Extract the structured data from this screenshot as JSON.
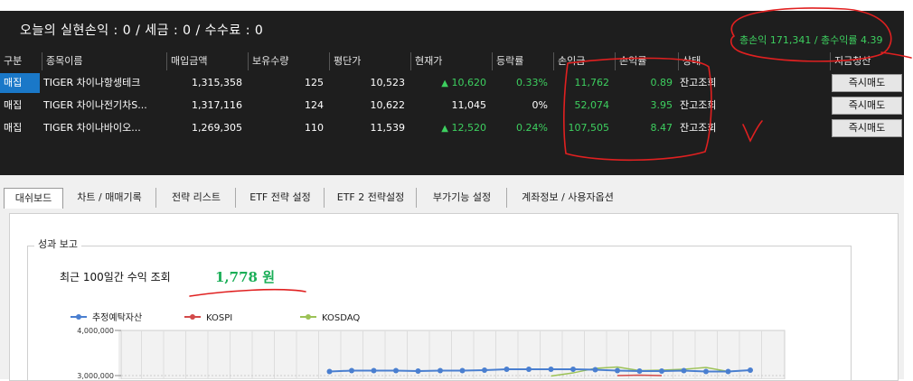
{
  "summary": "오늘의 실현손익 : 0 / 세금 : 0 / 수수료 : 0",
  "totals": "총손익 171,341 / 총수익률 4.39",
  "columns": [
    "구분",
    "종목이름",
    "매입금액",
    "보유수량",
    "평단가",
    "현재가",
    "등락률",
    "손익금",
    "손익률",
    "상태",
    "지금청산"
  ],
  "rows": [
    {
      "type": "매집",
      "name": "TIGER 차이나항셍테크",
      "buy": "1,315,358",
      "qty": "125",
      "avg": "10,523",
      "cur": "10,620",
      "up": true,
      "rate": "0.33%",
      "pnl": "11,762",
      "pnl_rate": "0.89",
      "status": "잔고조회",
      "action": "즉시매도"
    },
    {
      "type": "매집",
      "name": "TIGER 차이나전기차S...",
      "buy": "1,317,116",
      "qty": "124",
      "avg": "10,622",
      "cur": "11,045",
      "up": false,
      "rate": "0%",
      "pnl": "52,074",
      "pnl_rate": "3.95",
      "status": "잔고조회",
      "action": "즉시매도"
    },
    {
      "type": "매집",
      "name": "TIGER 차이나바이오...",
      "buy": "1,269,305",
      "qty": "110",
      "avg": "11,539",
      "cur": "12,520",
      "up": true,
      "rate": "0.24%",
      "pnl": "107,505",
      "pnl_rate": "8.47",
      "status": "잔고조회",
      "action": "즉시매도"
    }
  ],
  "tabs": [
    "대쉬보드",
    "차트 / 매매기록",
    "전략 리스트",
    "ETF 전략 설정",
    "ETF 2 전략설정",
    "부가기능 설정",
    "계좌정보 / 사용자옵션"
  ],
  "report": {
    "group_title": "성과 보고",
    "label": "최근 100일간 수익 조회",
    "value": "1,778 원"
  },
  "chart_data": {
    "type": "line",
    "series": [
      {
        "name": "추정예탁자산",
        "color": "#4a7fd0",
        "values": [
          null,
          null,
          null,
          null,
          null,
          null,
          null,
          null,
          null,
          3090000,
          3110000,
          3110000,
          3110000,
          3100000,
          3110000,
          3110000,
          3120000,
          3140000,
          3140000,
          3140000,
          3140000,
          3130000,
          3110000,
          3100000,
          3100000,
          3110000,
          3090000,
          3090000,
          3120000
        ]
      },
      {
        "name": "KOSPI",
        "color": "#d34a4a",
        "values": [
          null,
          null,
          null,
          null,
          null,
          null,
          null,
          null,
          null,
          null,
          null,
          null,
          null,
          null,
          null,
          null,
          null,
          null,
          null,
          null,
          null,
          null,
          3000000,
          3010000,
          3000000,
          null,
          null,
          null,
          null
        ]
      },
      {
        "name": "KOSDAQ",
        "color": "#9cc256",
        "values": [
          null,
          null,
          null,
          null,
          null,
          null,
          null,
          null,
          null,
          null,
          null,
          null,
          null,
          null,
          null,
          null,
          null,
          null,
          null,
          2990000,
          3060000,
          3160000,
          3190000,
          3110000,
          3120000,
          3140000,
          3180000,
          3090000,
          3120000
        ]
      }
    ],
    "yticks": [
      "4,000,000",
      "3,000,000"
    ],
    "ylim": [
      2900000,
      4000000
    ]
  }
}
